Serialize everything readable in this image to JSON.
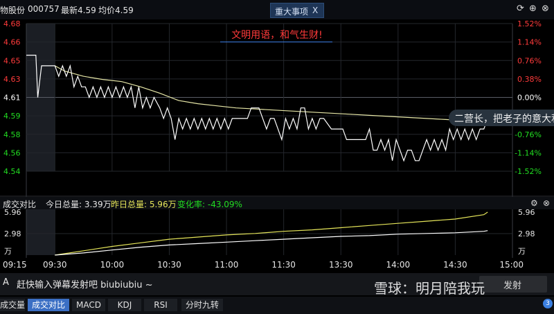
{
  "header": {
    "stock_name": "物股份",
    "stock_code": "000757",
    "latest_label": "最新4.59",
    "avg_label": "均价4.59",
    "news_label": "重大事项",
    "news_close": "X",
    "icons": [
      "refresh-icon",
      "add-icon",
      "close-icon"
    ]
  },
  "banner": "文明用语，和气生财!",
  "bubble": "二营长，把老子的意大利炮拉出来",
  "sub_header": {
    "title": "成交对比",
    "today_volume": "今日总量: 3.39万",
    "yesterday_volume": "昨日总量: 5.96万",
    "change_rate": "变化率: -43.09%"
  },
  "input": {
    "prefix": "A",
    "placeholder": "赶快输入弹幕发射吧 biubiubiu ~",
    "send_label": "发射"
  },
  "watermark": "雪球：明月陪我玩",
  "tabs": [
    "成交量",
    "成交对比",
    "MACD",
    "KDJ",
    "RSI",
    "分时九转"
  ],
  "badge": "3",
  "colors": {
    "up": "#ff3b3b",
    "down": "#22dd22",
    "price_line": "#ffffff",
    "avg_line": "#e8e8a8",
    "today_vol": "#ffffff",
    "yesterday_vol": "#e6e65a"
  },
  "chart_data": [
    {
      "type": "line",
      "title": "",
      "ylim": [
        4.54,
        4.68
      ],
      "y_ticks": [
        "4.68",
        "4.66",
        "4.65",
        "4.63",
        "4.61",
        "4.59",
        "4.58",
        "4.56",
        "4.54"
      ],
      "pct_ticks": [
        "1.52%",
        "1.14%",
        "0.76%",
        "0.38%",
        "0.00%",
        "-0.38%",
        "-0.76%",
        "-1.14%",
        "-1.52%"
      ],
      "x_ticks": [
        "09:15",
        "09:30",
        "10:00",
        "10:30",
        "11:00",
        "11:30",
        "13:30",
        "14:00",
        "14:30",
        "15:00"
      ],
      "x_minutes": [
        0,
        15,
        45,
        75,
        105,
        135,
        165,
        195,
        225,
        255
      ],
      "series": [
        {
          "role": "price",
          "points": [
            [
              0,
              4.65
            ],
            [
              5,
              4.65
            ],
            [
              6,
              4.61
            ],
            [
              8,
              4.64
            ],
            [
              15,
              4.64
            ],
            [
              17,
              4.63
            ],
            [
              19,
              4.64
            ],
            [
              21,
              4.63
            ],
            [
              23,
              4.64
            ],
            [
              25,
              4.62
            ],
            [
              27,
              4.63
            ],
            [
              29,
              4.62
            ],
            [
              31,
              4.62
            ],
            [
              33,
              4.61
            ],
            [
              35,
              4.62
            ],
            [
              37,
              4.61
            ],
            [
              39,
              4.62
            ],
            [
              41,
              4.61
            ],
            [
              43,
              4.62
            ],
            [
              45,
              4.61
            ],
            [
              47,
              4.62
            ],
            [
              49,
              4.61
            ],
            [
              51,
              4.62
            ],
            [
              53,
              4.61
            ],
            [
              55,
              4.62
            ],
            [
              57,
              4.6
            ],
            [
              59,
              4.62
            ],
            [
              61,
              4.6
            ],
            [
              63,
              4.61
            ],
            [
              65,
              4.6
            ],
            [
              67,
              4.61
            ],
            [
              70,
              4.6
            ],
            [
              72,
              4.59
            ],
            [
              74,
              4.6
            ],
            [
              76,
              4.59
            ],
            [
              78,
              4.57
            ],
            [
              80,
              4.59
            ],
            [
              82,
              4.58
            ],
            [
              84,
              4.59
            ],
            [
              86,
              4.58
            ],
            [
              88,
              4.59
            ],
            [
              90,
              4.58
            ],
            [
              92,
              4.59
            ],
            [
              94,
              4.58
            ],
            [
              96,
              4.59
            ],
            [
              98,
              4.58
            ],
            [
              100,
              4.59
            ],
            [
              102,
              4.58
            ],
            [
              104,
              4.59
            ],
            [
              106,
              4.58
            ],
            [
              108,
              4.59
            ],
            [
              110,
              4.59
            ],
            [
              116,
              4.59
            ],
            [
              118,
              4.6
            ],
            [
              122,
              4.6
            ],
            [
              124,
              4.59
            ],
            [
              126,
              4.58
            ],
            [
              128,
              4.59
            ],
            [
              130,
              4.59
            ],
            [
              132,
              4.58
            ],
            [
              134,
              4.57
            ],
            [
              136,
              4.59
            ],
            [
              138,
              4.58
            ],
            [
              140,
              4.59
            ],
            [
              142,
              4.58
            ],
            [
              144,
              4.6
            ],
            [
              146,
              4.6
            ],
            [
              148,
              4.58
            ],
            [
              150,
              4.59
            ],
            [
              152,
              4.58
            ],
            [
              154,
              4.59
            ],
            [
              156,
              4.59
            ],
            [
              160,
              4.58
            ],
            [
              162,
              4.58
            ],
            [
              166,
              4.58
            ],
            [
              168,
              4.57
            ],
            [
              170,
              4.57
            ],
            [
              178,
              4.57
            ],
            [
              180,
              4.58
            ],
            [
              182,
              4.56
            ],
            [
              184,
              4.56
            ],
            [
              186,
              4.57
            ],
            [
              188,
              4.56
            ],
            [
              190,
              4.57
            ],
            [
              192,
              4.55
            ],
            [
              194,
              4.57
            ],
            [
              196,
              4.56
            ],
            [
              198,
              4.55
            ],
            [
              200,
              4.56
            ],
            [
              202,
              4.56
            ],
            [
              204,
              4.55
            ],
            [
              206,
              4.55
            ],
            [
              208,
              4.56
            ],
            [
              210,
              4.57
            ],
            [
              212,
              4.56
            ],
            [
              214,
              4.57
            ],
            [
              216,
              4.56
            ],
            [
              218,
              4.57
            ],
            [
              220,
              4.56
            ],
            [
              222,
              4.58
            ],
            [
              224,
              4.57
            ],
            [
              226,
              4.58
            ],
            [
              228,
              4.57
            ],
            [
              230,
              4.58
            ],
            [
              232,
              4.57
            ],
            [
              234,
              4.58
            ],
            [
              236,
              4.57
            ],
            [
              238,
              4.58
            ],
            [
              240,
              4.58
            ],
            [
              242,
              4.59
            ]
          ]
        },
        {
          "role": "average",
          "points": [
            [
              15,
              4.64
            ],
            [
              20,
              4.635
            ],
            [
              30,
              4.63
            ],
            [
              40,
              4.627
            ],
            [
              50,
              4.625
            ],
            [
              60,
              4.62
            ],
            [
              70,
              4.614
            ],
            [
              80,
              4.607
            ],
            [
              90,
              4.604
            ],
            [
              100,
              4.602
            ],
            [
              110,
              4.6
            ],
            [
              120,
              4.599
            ],
            [
              130,
              4.598
            ],
            [
              140,
              4.597
            ],
            [
              150,
              4.596
            ],
            [
              160,
              4.595
            ],
            [
              170,
              4.594
            ],
            [
              180,
              4.593
            ],
            [
              190,
              4.592
            ],
            [
              200,
              4.591
            ],
            [
              210,
              4.59
            ],
            [
              220,
              4.589
            ],
            [
              230,
              4.588
            ],
            [
              242,
              4.588
            ]
          ]
        }
      ]
    },
    {
      "type": "area",
      "title": "成交对比",
      "ylim": [
        0,
        5.96
      ],
      "y_ticks": [
        "5.96",
        "2.98",
        "万"
      ],
      "y_unit": "万",
      "series": [
        {
          "name": "昨日总量",
          "points": [
            [
              15,
              0
            ],
            [
              30,
              0.6
            ],
            [
              45,
              1.2
            ],
            [
              60,
              1.7
            ],
            [
              75,
              2.2
            ],
            [
              90,
              2.5
            ],
            [
              105,
              2.8
            ],
            [
              120,
              3.0
            ],
            [
              135,
              3.3
            ],
            [
              150,
              3.5
            ],
            [
              165,
              3.8
            ],
            [
              180,
              4.1
            ],
            [
              195,
              4.4
            ],
            [
              210,
              4.7
            ],
            [
              225,
              5.0
            ],
            [
              240,
              5.6
            ],
            [
              242,
              5.96
            ]
          ]
        },
        {
          "name": "今日总量",
          "points": [
            [
              15,
              0
            ],
            [
              30,
              0.3
            ],
            [
              45,
              0.7
            ],
            [
              60,
              1.1
            ],
            [
              75,
              1.4
            ],
            [
              90,
              1.6
            ],
            [
              105,
              1.8
            ],
            [
              120,
              2.0
            ],
            [
              135,
              2.2
            ],
            [
              150,
              2.4
            ],
            [
              165,
              2.6
            ],
            [
              180,
              2.7
            ],
            [
              195,
              2.9
            ],
            [
              210,
              3.0
            ],
            [
              225,
              3.1
            ],
            [
              240,
              3.3
            ],
            [
              242,
              3.39
            ]
          ]
        }
      ]
    }
  ]
}
